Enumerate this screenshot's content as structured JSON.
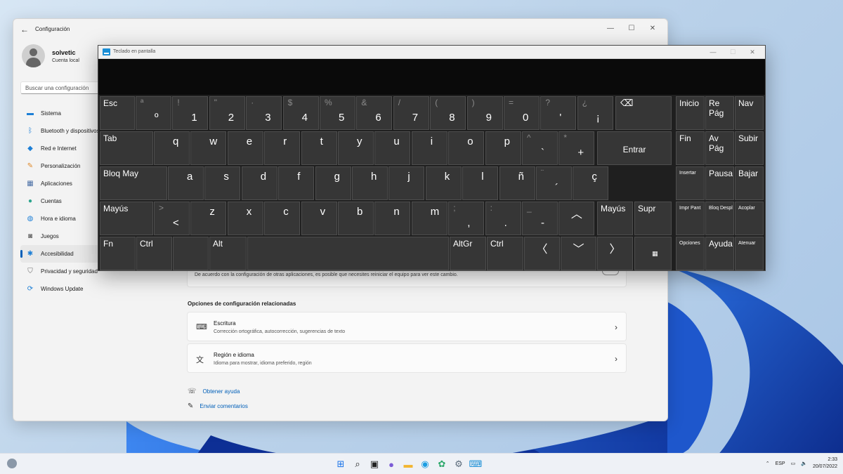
{
  "settings": {
    "title": "Configuración",
    "user_name": "solvetic",
    "account_type": "Cuenta local",
    "search_placeholder": "Buscar una configuración",
    "nav": [
      {
        "label": "Sistema",
        "icon": "monitor-icon",
        "color": "#1d7fd6"
      },
      {
        "label": "Bluetooth y dispositivos",
        "icon": "bluetooth-icon",
        "color": "#1d7fd6"
      },
      {
        "label": "Red e Internet",
        "icon": "wifi-icon",
        "color": "#1d7fd6"
      },
      {
        "label": "Personalización",
        "icon": "brush-icon",
        "color": "#e08a2a"
      },
      {
        "label": "Aplicaciones",
        "icon": "apps-icon",
        "color": "#4a6fa5"
      },
      {
        "label": "Cuentas",
        "icon": "person-icon",
        "color": "#2ca58d"
      },
      {
        "label": "Hora e idioma",
        "icon": "globe-clock-icon",
        "color": "#1d7fd6"
      },
      {
        "label": "Juegos",
        "icon": "gamepad-icon",
        "color": "#6b6b6b"
      },
      {
        "label": "Accesibilidad",
        "icon": "accessibility-icon",
        "color": "#1d7fd6",
        "active": true
      },
      {
        "label": "Privacidad y seguridad",
        "icon": "shield-icon",
        "color": "#6b6b6b"
      },
      {
        "label": "Windows Update",
        "icon": "update-icon",
        "color": "#1d7fd6"
      }
    ],
    "partial_card_text": "De acuerdo con la configuración de otras aplicaciones, es posible que necesites reiniciar el equipo para ver este cambio.",
    "related_title": "Opciones de configuración relacionadas",
    "related": [
      {
        "title": "Escritura",
        "subtitle": "Corrección ortográfica, autocorrección, sugerencias de texto"
      },
      {
        "title": "Región e idioma",
        "subtitle": "Idioma para mostrar, idioma preferido, región"
      }
    ],
    "help_link": "Obtener ayuda",
    "feedback_link": "Enviar comentarios"
  },
  "osk": {
    "title": "Teclado en pantalla",
    "row1": [
      {
        "label": "Esc"
      },
      {
        "shift": "ª",
        "main": "º"
      },
      {
        "shift": "!",
        "main": "1"
      },
      {
        "shift": "\"",
        "main": "2"
      },
      {
        "shift": "·",
        "main": "3"
      },
      {
        "shift": "$",
        "main": "4"
      },
      {
        "shift": "%",
        "main": "5"
      },
      {
        "shift": "&",
        "main": "6"
      },
      {
        "shift": "/",
        "main": "7"
      },
      {
        "shift": "(",
        "main": "8"
      },
      {
        "shift": ")",
        "main": "9"
      },
      {
        "shift": "=",
        "main": "0"
      },
      {
        "shift": "?",
        "main": "'"
      },
      {
        "shift": "¿",
        "main": "¡"
      },
      {
        "icon": "backspace-icon",
        "glyph": "⌫"
      }
    ],
    "row2": [
      {
        "label": "Tab"
      },
      {
        "main": "q"
      },
      {
        "main": "w"
      },
      {
        "main": "e"
      },
      {
        "main": "r"
      },
      {
        "main": "t"
      },
      {
        "main": "y"
      },
      {
        "main": "u"
      },
      {
        "main": "i"
      },
      {
        "main": "o"
      },
      {
        "main": "p"
      },
      {
        "shift": "^",
        "main": "`"
      },
      {
        "shift": "*",
        "main": "+"
      },
      {
        "label": "Entrar"
      }
    ],
    "row3": [
      {
        "label": "Bloq May"
      },
      {
        "main": "a"
      },
      {
        "main": "s"
      },
      {
        "main": "d"
      },
      {
        "main": "f"
      },
      {
        "main": "g"
      },
      {
        "main": "h"
      },
      {
        "main": "j"
      },
      {
        "main": "k"
      },
      {
        "main": "l"
      },
      {
        "main": "ñ"
      },
      {
        "shift": "¨",
        "main": "´"
      },
      {
        "main": "ç"
      }
    ],
    "row4": [
      {
        "label": "Mayús"
      },
      {
        "shift": ">",
        "main": "<"
      },
      {
        "main": "z"
      },
      {
        "main": "x"
      },
      {
        "main": "c"
      },
      {
        "main": "v"
      },
      {
        "main": "b"
      },
      {
        "main": "n"
      },
      {
        "main": "m"
      },
      {
        "shift": ";",
        "main": ","
      },
      {
        "shift": ":",
        "main": "."
      },
      {
        "shift": "_",
        "main": "-"
      },
      {
        "icon": "arrow-up-icon",
        "glyph": "︿"
      },
      {
        "label": "Mayús"
      },
      {
        "label": "Supr"
      }
    ],
    "row5": [
      {
        "label": "Fn"
      },
      {
        "label": "Ctrl"
      },
      {
        "icon": "windows-logo-icon"
      },
      {
        "label": "Alt"
      },
      {
        "label": ""
      },
      {
        "label": "AltGr"
      },
      {
        "label": "Ctrl"
      },
      {
        "icon": "arrow-left-icon",
        "glyph": "〈"
      },
      {
        "icon": "arrow-down-icon",
        "glyph": "﹀"
      },
      {
        "icon": "arrow-right-icon",
        "glyph": "〉"
      },
      {
        "icon": "keyboard-icon",
        "glyph": "▦"
      }
    ],
    "nav_keys": [
      [
        "Inicio",
        "Re Pág",
        "Nav"
      ],
      [
        "Fin",
        "Av Pág",
        "Subir"
      ],
      [
        "Insertar",
        "Pausa",
        "Bajar"
      ],
      [
        "Impr Pant",
        "Bloq Despl",
        "Acoplar"
      ],
      [
        "Opciones",
        "Ayuda",
        "Atenuar"
      ]
    ]
  },
  "taskbar": {
    "apps": [
      {
        "icon": "windows-start-icon",
        "glyph": "⊞",
        "color": "#1a73e8"
      },
      {
        "icon": "search-icon",
        "glyph": "⌕",
        "color": "#222222"
      },
      {
        "icon": "task-view-icon",
        "glyph": "▣",
        "color": "#222222"
      },
      {
        "icon": "chat-icon",
        "glyph": "●",
        "color": "#7b5bd6"
      },
      {
        "icon": "file-explorer-icon",
        "glyph": "▬",
        "color": "#f2b632"
      },
      {
        "icon": "edge-icon",
        "glyph": "◉",
        "color": "#1b9de2"
      },
      {
        "icon": "store-icon",
        "glyph": "✿",
        "color": "#2ea86b"
      },
      {
        "icon": "settings-icon",
        "glyph": "⚙",
        "color": "#5a6a7a"
      },
      {
        "icon": "osk-app-icon",
        "glyph": "⌨",
        "color": "#1b8fd6"
      }
    ],
    "language": "ESP",
    "time": "2:33",
    "date": "20/07/2022"
  }
}
